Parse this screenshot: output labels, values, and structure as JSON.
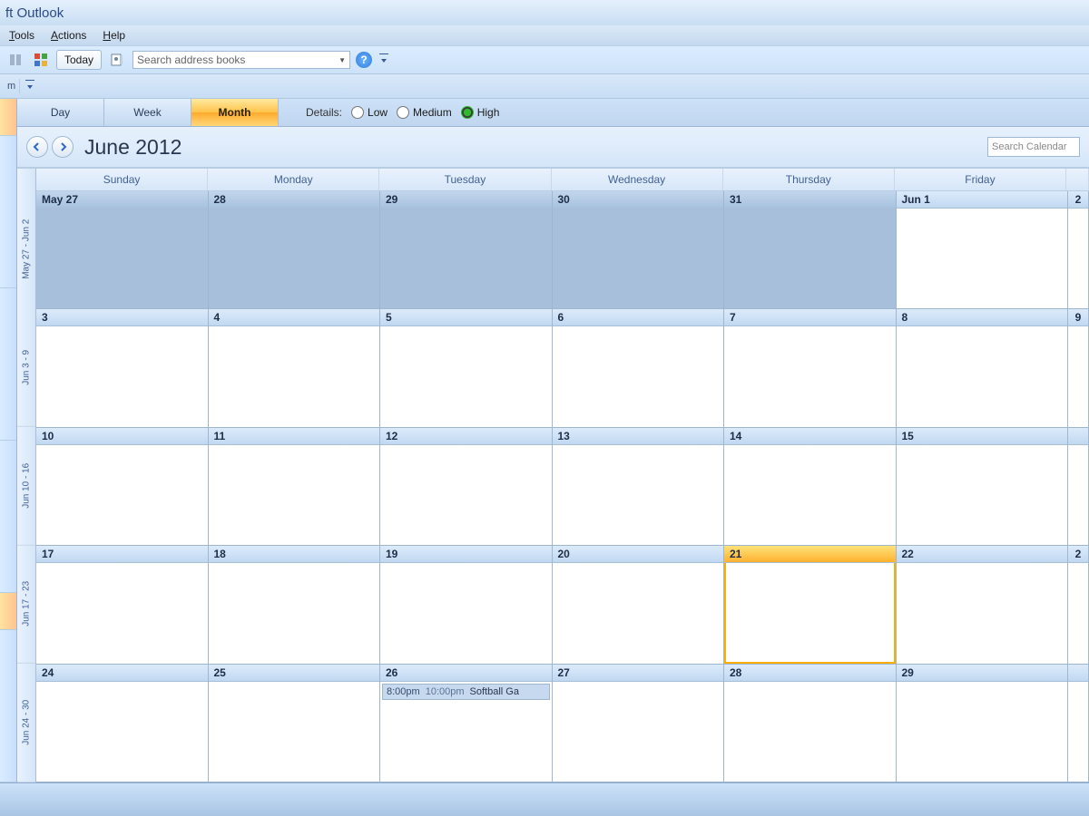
{
  "title_suffix": "ft Outlook",
  "menu": {
    "tools": "Tools",
    "actions": "Actions",
    "help": "Help"
  },
  "toolbar": {
    "today_label": "Today",
    "search_ab_placeholder": "Search address books"
  },
  "secondbar": {
    "label": "m"
  },
  "view_tabs": {
    "day": "Day",
    "week": "Week",
    "month": "Month",
    "active": "month"
  },
  "details": {
    "label": "Details:",
    "low": "Low",
    "medium": "Medium",
    "high": "High",
    "selected": "high"
  },
  "header": {
    "month_title": "June 2012",
    "search_placeholder": "Search Calendar"
  },
  "dow": [
    "Sunday",
    "Monday",
    "Tuesday",
    "Wednesday",
    "Thursday",
    "Friday",
    ""
  ],
  "week_labels": [
    "May 27 - Jun 2",
    "Jun 3 - 9",
    "Jun 10 - 16",
    "Jun 17 - 23",
    "Jun 24 - 30"
  ],
  "weeks": [
    {
      "days": [
        {
          "label": "May 27",
          "prev": true
        },
        {
          "label": "28",
          "prev": true
        },
        {
          "label": "29",
          "prev": true
        },
        {
          "label": "30",
          "prev": true
        },
        {
          "label": "31",
          "prev": true
        },
        {
          "label": "Jun 1"
        },
        {
          "label": "2",
          "sat": true
        }
      ]
    },
    {
      "days": [
        {
          "label": "3"
        },
        {
          "label": "4"
        },
        {
          "label": "5"
        },
        {
          "label": "6"
        },
        {
          "label": "7"
        },
        {
          "label": "8"
        },
        {
          "label": "9",
          "sat": true
        }
      ]
    },
    {
      "days": [
        {
          "label": "10"
        },
        {
          "label": "11"
        },
        {
          "label": "12"
        },
        {
          "label": "13"
        },
        {
          "label": "14"
        },
        {
          "label": "15"
        },
        {
          "label": "",
          "sat": true
        }
      ]
    },
    {
      "days": [
        {
          "label": "17"
        },
        {
          "label": "18"
        },
        {
          "label": "19"
        },
        {
          "label": "20"
        },
        {
          "label": "21",
          "today": true
        },
        {
          "label": "22"
        },
        {
          "label": "2",
          "sat": true
        }
      ]
    },
    {
      "days": [
        {
          "label": "24"
        },
        {
          "label": "25"
        },
        {
          "label": "26",
          "event": {
            "start": "8:00pm",
            "end": "10:00pm",
            "title": "Softball Ga"
          }
        },
        {
          "label": "27"
        },
        {
          "label": "28"
        },
        {
          "label": "29"
        },
        {
          "label": "",
          "sat": true
        }
      ]
    }
  ]
}
